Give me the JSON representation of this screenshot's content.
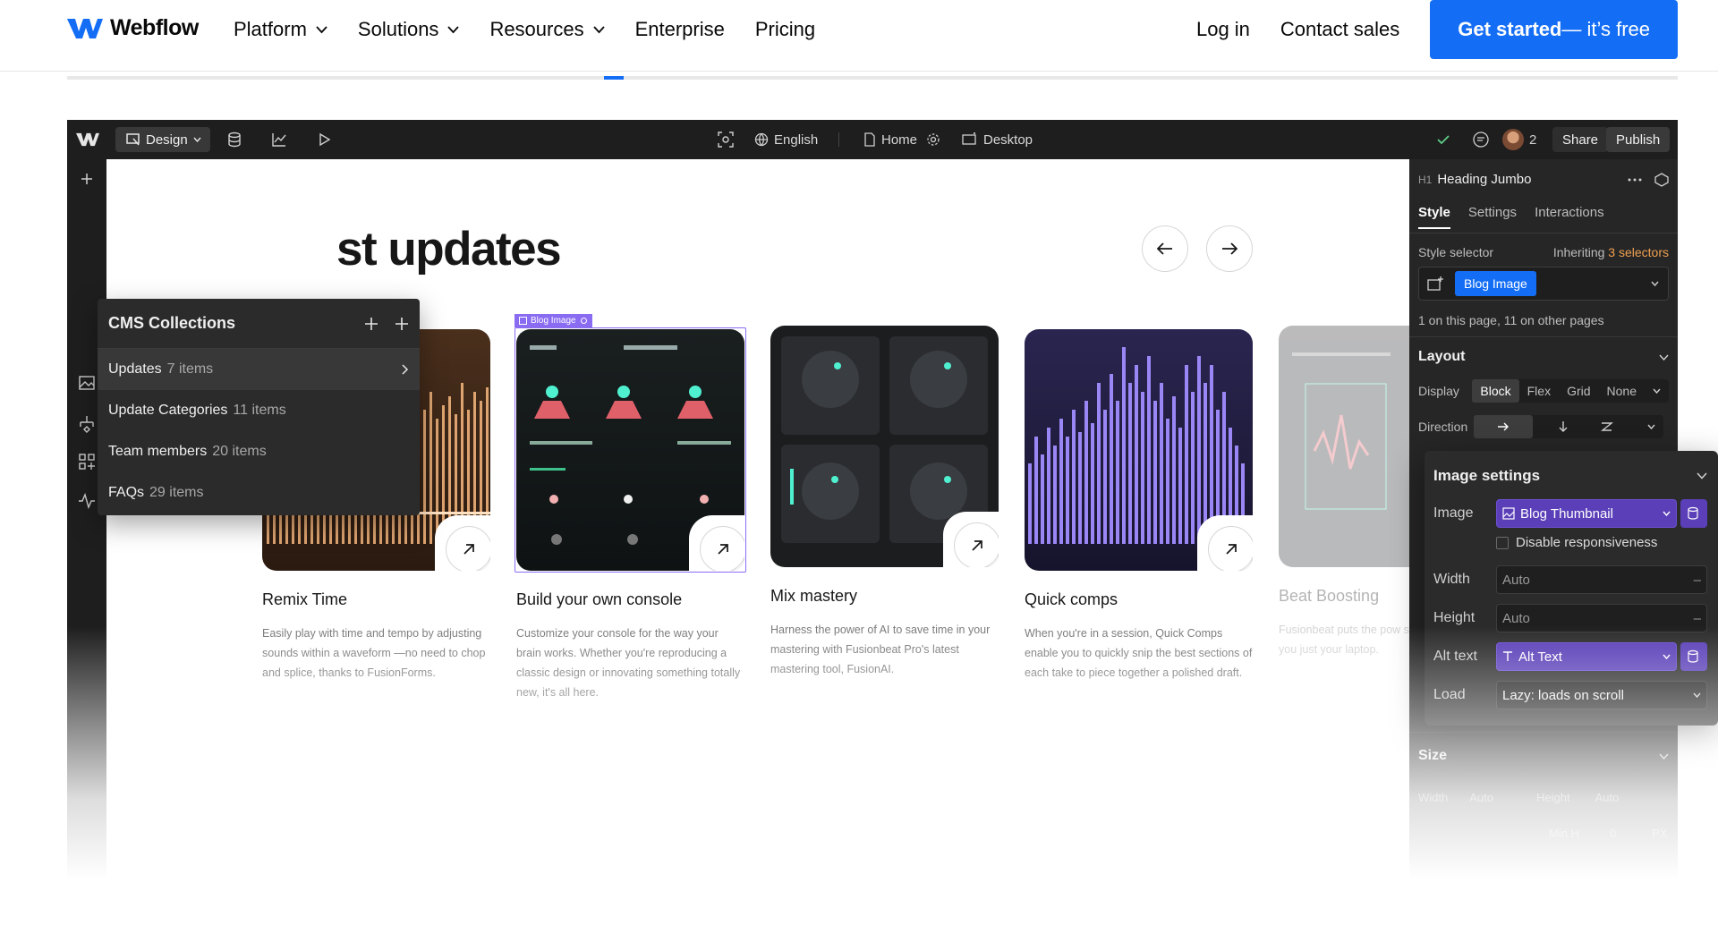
{
  "site_nav": {
    "logo_text": "Webflow",
    "links": [
      {
        "label": "Platform"
      },
      {
        "label": "Solutions"
      },
      {
        "label": "Resources"
      },
      {
        "label": "Enterprise"
      },
      {
        "label": "Pricing"
      }
    ],
    "login": "Log in",
    "contact": "Contact sales",
    "cta_main": "Get started",
    "cta_suffix": " — it’s free"
  },
  "colors": {
    "brand_blue": "#146ef5",
    "cms_purple": "#5a3fb8",
    "selection": "#8a6cf2"
  },
  "designer_toolbar": {
    "mode": "Design",
    "language": "English",
    "page": "Home",
    "breakpoint": "Desktop",
    "collaborators": "2",
    "share": "Share",
    "publish": "Publish"
  },
  "canvas": {
    "heading": "st updates",
    "cards": [
      {
        "title": "Remix Time",
        "desc": "Easily play with time and tempo by adjusting sounds within a waveform —no need to chop and splice, thanks to FusionForms."
      },
      {
        "title": "Build your own console",
        "desc": "Customize your console for the way your brain works. Whether you're reproducing a classic design or innovating something totally new, it's all here.",
        "tag": "Blog Image"
      },
      {
        "title": "Mix mastery",
        "desc": "Harness the power of AI to save time in your mastering with Fusionbeat Pro's latest mastering tool, FusionAI."
      },
      {
        "title": "Quick comps",
        "desc": "When you're in a session, Quick Comps enable you to quickly snip the best sections of each take to piece together a polished draft."
      },
      {
        "title": "Beat Boosting",
        "desc": "Fusionbeat puts the pow sized console under you just your laptop."
      }
    ]
  },
  "cms": {
    "title": "CMS Collections",
    "rows": [
      {
        "name": "Updates",
        "count": "7 items"
      },
      {
        "name": "Update Categories",
        "count": "11 items"
      },
      {
        "name": "Team members",
        "count": "20 items"
      },
      {
        "name": "FAQs",
        "count": "29 items"
      }
    ]
  },
  "style_panel": {
    "element_tag": "H1",
    "element_name": "Heading Jumbo",
    "tabs": [
      "Style",
      "Settings",
      "Interactions"
    ],
    "selector_label": "Style selector",
    "inheriting": "Inheriting",
    "inheriting_count": "3 selectors",
    "class_chip": "Blog Image",
    "usage": "1 on this page, 11 on other pages",
    "layout_title": "Layout",
    "display_label": "Display",
    "display_options": [
      "Block",
      "Flex",
      "Grid",
      "None"
    ],
    "direction_label": "Direction",
    "size_title": "Size",
    "size_width_label": "Width",
    "size_width_value": "Auto",
    "size_height_label": "Height",
    "size_height_value": "Auto",
    "size_min_label": "Min H",
    "size_min_value": "0",
    "size_unit": "PX"
  },
  "image_settings": {
    "title": "Image settings",
    "image_label": "Image",
    "image_value": "Blog Thumbnail",
    "disable_resp": "Disable responsiveness",
    "width_label": "Width",
    "width_value": "Auto",
    "height_label": "Height",
    "height_value": "Auto",
    "alt_label": "Alt text",
    "alt_value": "Alt Text",
    "load_label": "Load",
    "load_value": "Lazy: loads on scroll"
  }
}
